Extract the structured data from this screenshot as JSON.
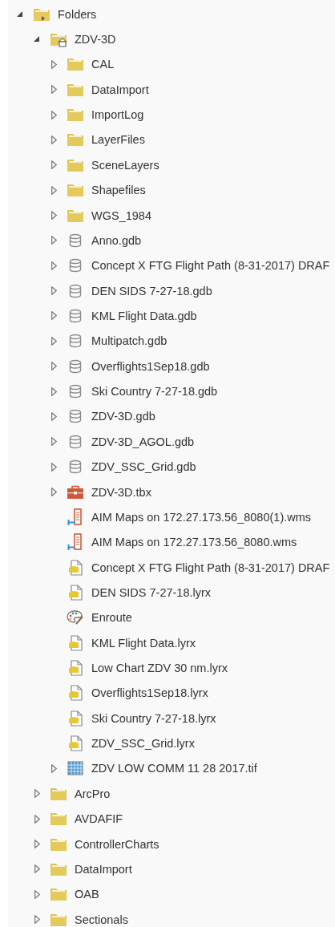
{
  "tree": [
    {
      "label": "Folders",
      "kind": "folders-root",
      "expanded": true,
      "children": [
        {
          "label": "ZDV-3D",
          "kind": "home-folder",
          "expanded": true,
          "children": [
            {
              "label": "CAL",
              "kind": "folder",
              "expanded": false
            },
            {
              "label": "DataImport",
              "kind": "folder",
              "expanded": false
            },
            {
              "label": "ImportLog",
              "kind": "folder",
              "expanded": false
            },
            {
              "label": "LayerFiles",
              "kind": "folder",
              "expanded": false
            },
            {
              "label": "SceneLayers",
              "kind": "folder",
              "expanded": false
            },
            {
              "label": "Shapefiles",
              "kind": "folder",
              "expanded": false
            },
            {
              "label": "WGS_1984",
              "kind": "folder",
              "expanded": false
            },
            {
              "label": "Anno.gdb",
              "kind": "geodatabase",
              "expanded": false
            },
            {
              "label": "Concept X FTG Flight Path (8-31-2017) DRAF",
              "kind": "geodatabase",
              "expanded": false
            },
            {
              "label": "DEN SIDS 7-27-18.gdb",
              "kind": "geodatabase",
              "expanded": false
            },
            {
              "label": "KML Flight Data.gdb",
              "kind": "geodatabase",
              "expanded": false
            },
            {
              "label": "Multipatch.gdb",
              "kind": "geodatabase",
              "expanded": false
            },
            {
              "label": "Overflights1Sep18.gdb",
              "kind": "geodatabase",
              "expanded": false
            },
            {
              "label": "Ski Country 7-27-18.gdb",
              "kind": "geodatabase",
              "expanded": false
            },
            {
              "label": "ZDV-3D.gdb",
              "kind": "geodatabase",
              "expanded": false
            },
            {
              "label": "ZDV-3D_AGOL.gdb",
              "kind": "geodatabase",
              "expanded": false
            },
            {
              "label": "ZDV_SSC_Grid.gdb",
              "kind": "geodatabase",
              "expanded": false
            },
            {
              "label": "ZDV-3D.tbx",
              "kind": "toolbox",
              "expanded": false
            },
            {
              "label": "AIM Maps on 172.27.173.56_8080(1).wms",
              "kind": "server"
            },
            {
              "label": "AIM Maps on 172.27.173.56_8080.wms",
              "kind": "server"
            },
            {
              "label": "Concept X FTG Flight Path (8-31-2017) DRAF",
              "kind": "layer-file"
            },
            {
              "label": "DEN SIDS 7-27-18.lyrx",
              "kind": "layer-file"
            },
            {
              "label": "Enroute",
              "kind": "style"
            },
            {
              "label": "KML Flight Data.lyrx",
              "kind": "layer-file"
            },
            {
              "label": "Low Chart ZDV 30 nm.lyrx",
              "kind": "layer-file"
            },
            {
              "label": "Overflights1Sep18.lyrx",
              "kind": "layer-file"
            },
            {
              "label": "Ski Country 7-27-18.lyrx",
              "kind": "layer-file"
            },
            {
              "label": "ZDV_SSC_Grid.lyrx",
              "kind": "layer-file"
            },
            {
              "label": "ZDV LOW COMM 11 28 2017.tif",
              "kind": "raster",
              "expanded": false
            }
          ]
        },
        {
          "label": "ArcPro",
          "kind": "folder",
          "expanded": false
        },
        {
          "label": "AVDAFIF",
          "kind": "folder",
          "expanded": false
        },
        {
          "label": "ControllerCharts",
          "kind": "folder",
          "expanded": false
        },
        {
          "label": "DataImport",
          "kind": "folder",
          "expanded": false
        },
        {
          "label": "OAB",
          "kind": "folder",
          "expanded": false
        },
        {
          "label": "Sectionals",
          "kind": "folder",
          "expanded": false
        }
      ]
    }
  ]
}
